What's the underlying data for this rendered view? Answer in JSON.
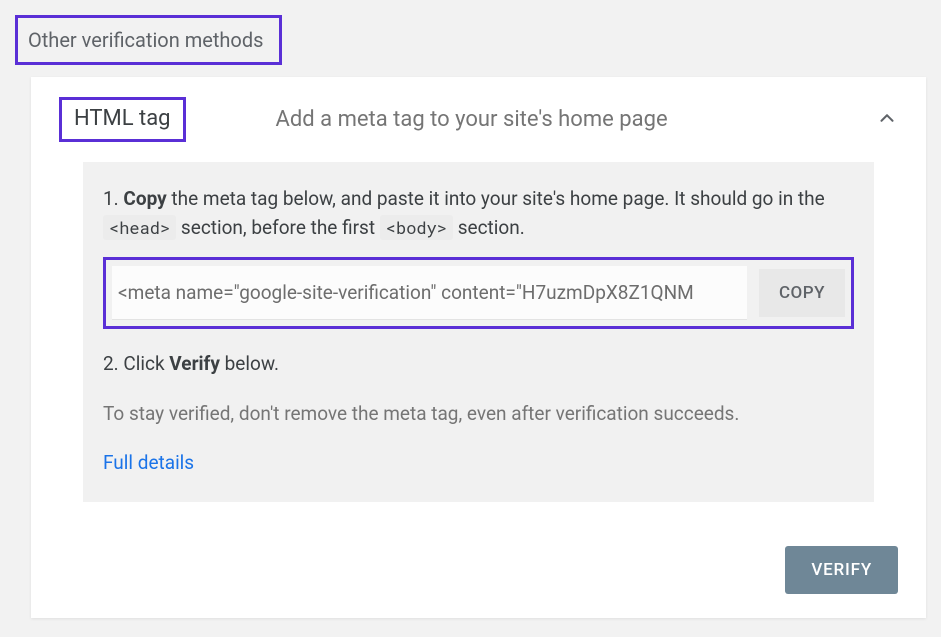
{
  "section_heading": "Other verification methods",
  "method": {
    "name": "HTML tag",
    "subtitle": "Add a meta tag to your site's home page"
  },
  "step1": {
    "prefix": "1. ",
    "bold": "Copy",
    "after_bold": " the meta tag below, and paste it into your site's home page. It should go in the ",
    "code1": "<head>",
    "mid": " section, before the first ",
    "code2": "<body>",
    "tail": " section."
  },
  "meta_tag_value": "<meta name=\"google-site-verification\" content=\"H7uzmDpX8Z1QNM",
  "copy_label": "COPY",
  "step2": {
    "prefix": "2. Click ",
    "bold": "Verify",
    "tail": " below."
  },
  "note": "To stay verified, don't remove the meta tag, even after verification succeeds.",
  "details_link": "Full details",
  "verify_label": "VERIFY"
}
